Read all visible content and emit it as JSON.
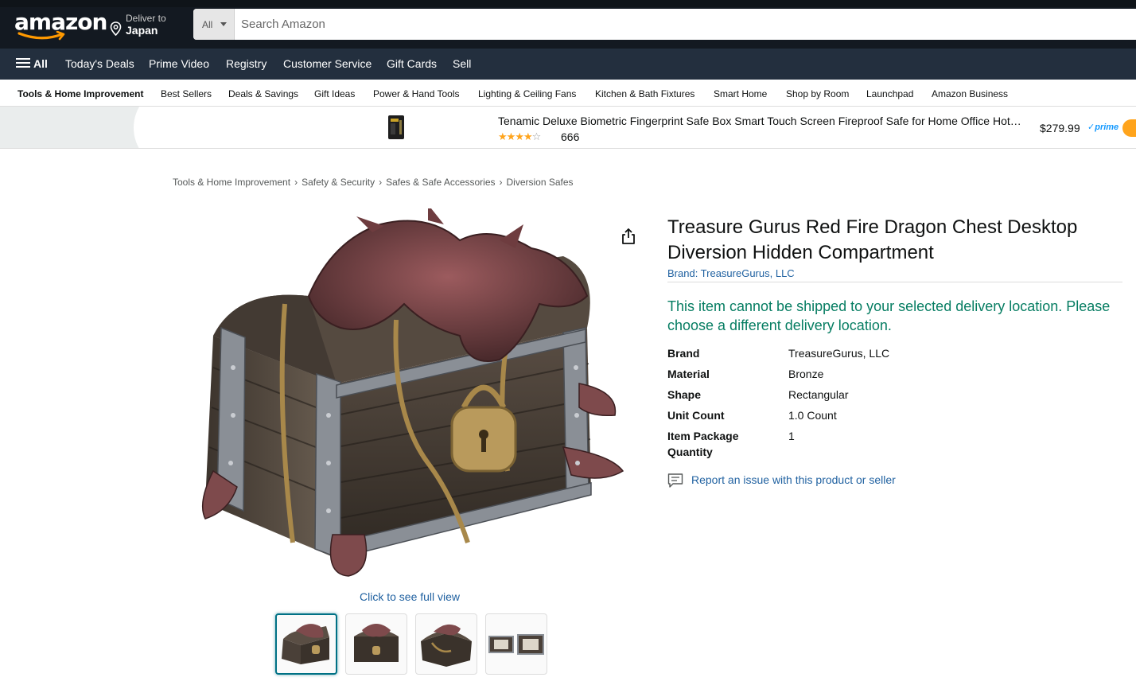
{
  "header": {
    "logo_text": "amazon",
    "deliver_line1": "Deliver to",
    "deliver_line2": "Japan",
    "search_category": "All",
    "search_placeholder": "Search Amazon"
  },
  "main_nav": {
    "all_label": "All",
    "items": [
      "Today's Deals",
      "Prime Video",
      "Registry",
      "Customer Service",
      "Gift Cards",
      "Sell"
    ]
  },
  "sub_nav": {
    "items": [
      "Tools & Home Improvement",
      "Best Sellers",
      "Deals & Savings",
      "Gift Ideas",
      "Power & Hand Tools",
      "Lighting & Ceiling Fans",
      "Kitchen & Bath Fixtures",
      "Smart Home",
      "Shop by Room",
      "Launchpad",
      "Amazon Business"
    ]
  },
  "promo": {
    "title": "Tenamic Deluxe Biometric Fingerprint Safe Box Smart Touch Screen Fireproof Safe for Home Office Hot…",
    "rating": 4.0,
    "review_count": "666",
    "price": "$279.99",
    "prime_label": "prime"
  },
  "breadcrumb": [
    "Tools & Home Improvement",
    "Safety & Security",
    "Safes & Safe Accessories",
    "Diversion Safes"
  ],
  "gallery": {
    "full_view_label": "Click to see full view",
    "thumbnail_count": 4,
    "selected_index": 0
  },
  "product": {
    "title": "Treasure Gurus Red Fire Dragon Chest Desktop Diversion Hidden Compartment",
    "brand_link": "Brand: TreasureGurus, LLC",
    "shipping_warning": "This item cannot be shipped to your selected delivery location. Please choose a different delivery location.",
    "specs": [
      {
        "key": "Brand",
        "value": "TreasureGurus, LLC"
      },
      {
        "key": "Material",
        "value": "Bronze"
      },
      {
        "key": "Shape",
        "value": "Rectangular"
      },
      {
        "key": "Unit Count",
        "value": "1.0 Count"
      },
      {
        "key": "Item Package Quantity",
        "value": "1"
      }
    ],
    "report_label": "Report an issue with this product or seller"
  },
  "colors": {
    "nav_dark": "#131921",
    "nav_mid": "#232f3e",
    "link": "#2162a1",
    "success_green": "#067d62",
    "star": "#ffa41c",
    "accent_teal": "#007185"
  }
}
